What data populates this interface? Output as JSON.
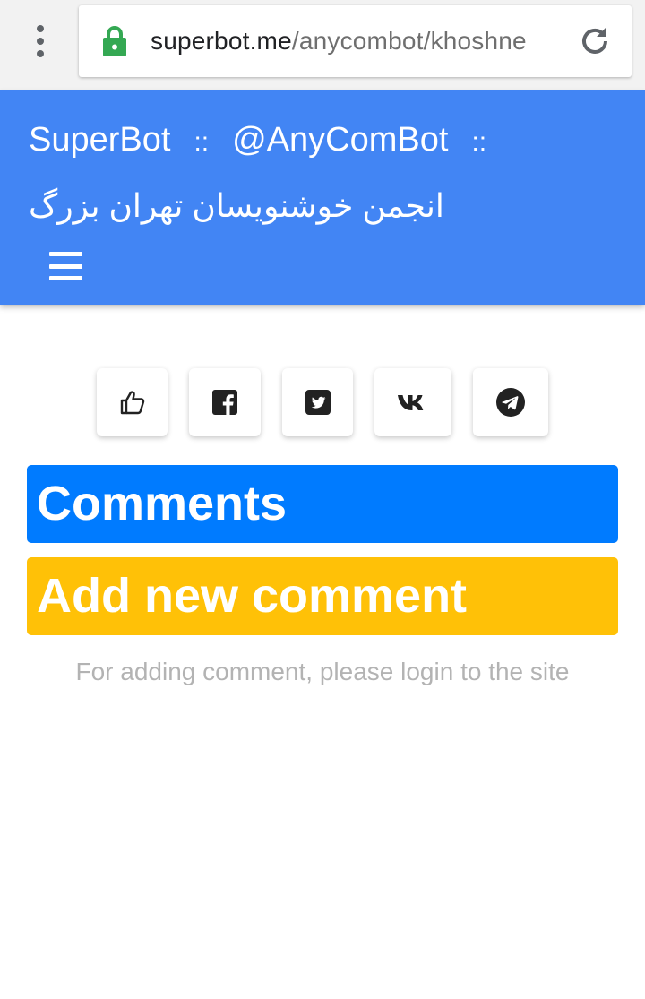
{
  "browser": {
    "url_host": "superbot.me",
    "url_path": "/anycombot/khoshne",
    "icons": {
      "menu": "more-vert-icon",
      "lock": "lock-icon",
      "reload": "reload-icon"
    },
    "colors": {
      "lock": "#34a853",
      "chrome_bg": "#f2f2f2"
    }
  },
  "header": {
    "brand": "SuperBot",
    "separator1": "::",
    "bot_handle": "@AnyComBot",
    "separator2": "::",
    "subtitle": "انجمن خوشنویسان تهران بزرگ",
    "menu_icon": "hamburger-menu-icon",
    "background": "#4285f4"
  },
  "share": {
    "buttons": [
      {
        "name": "like-button",
        "icon": "thumbs-up-icon"
      },
      {
        "name": "facebook-share-button",
        "icon": "facebook-icon"
      },
      {
        "name": "twitter-share-button",
        "icon": "twitter-icon"
      },
      {
        "name": "vk-share-button",
        "icon": "vk-icon"
      },
      {
        "name": "telegram-share-button",
        "icon": "telegram-icon"
      }
    ]
  },
  "comments": {
    "heading": "Comments",
    "heading_color": "#007bff",
    "add_heading": "Add new comment",
    "add_color": "#ffc107",
    "login_note": "For adding comment, please login to the site"
  }
}
